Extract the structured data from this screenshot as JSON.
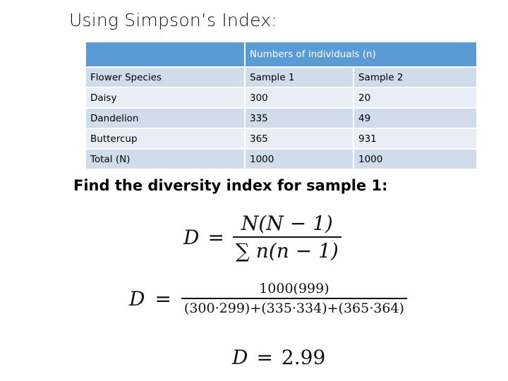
{
  "slide": {
    "title": "Using Simpson’s Index:",
    "subtitle": "Find  the diversity index for sample 1:"
  },
  "table": {
    "group_header": "Numbers of individuals  (n)",
    "columns": [
      "Flower Species",
      "Sample 1",
      "Sample 2"
    ],
    "rows": [
      [
        "Daisy",
        "300",
        "20"
      ],
      [
        "Dandelion",
        "335",
        "49"
      ],
      [
        "Buttercup",
        "365",
        "931"
      ],
      [
        "Total (N)",
        "1000",
        "1000"
      ]
    ],
    "colors": {
      "header": "#5b9bd5",
      "band_dark": "#d0dbeb",
      "band_light": "#e9edf5"
    }
  },
  "equations": {
    "formula": {
      "lhs": "D",
      "eq": "=",
      "numerator": "N(N − 1)",
      "denominator": "∑ n(n − 1)"
    },
    "substituted": {
      "lhs": "D",
      "eq": "=",
      "numerator": "1000(999)",
      "denominator": "(300·299)+(335·334)+(365·364)"
    },
    "result": {
      "lhs": "D",
      "eq": "=",
      "value": "2.99"
    }
  }
}
